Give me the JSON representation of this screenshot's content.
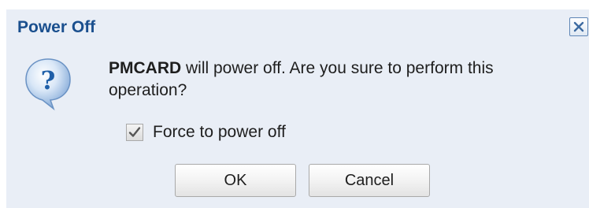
{
  "dialog": {
    "title": "Power Off",
    "close_icon": "close-icon",
    "question_icon": "question-mark-bubble-icon",
    "message": {
      "target": "PMCARD",
      "text": " will power off. Are you sure to perform this operation?"
    },
    "force_option": {
      "label": "Force to power off",
      "checked": true,
      "check_icon": "checkmark-icon"
    },
    "buttons": {
      "ok": "OK",
      "cancel": "Cancel"
    },
    "colors": {
      "title": "#1a4f8e",
      "background": "#e9eef6",
      "icon_blue": "#1f5fa8"
    }
  }
}
